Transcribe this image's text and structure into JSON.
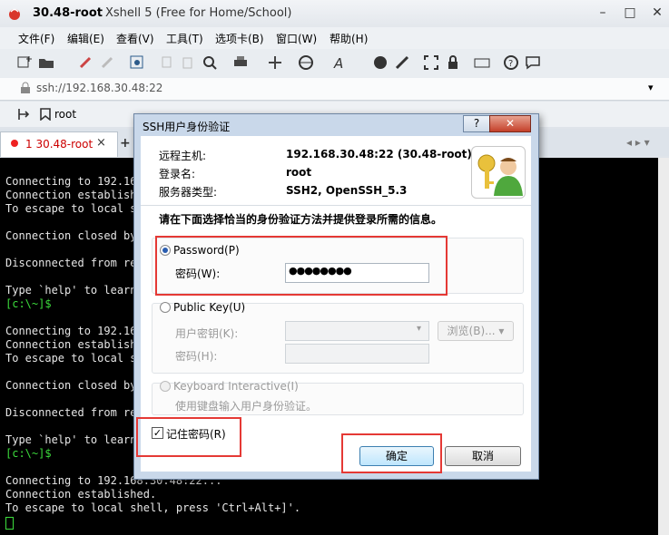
{
  "window": {
    "title_bold": "30.48-root",
    "title_rest": "Xshell 5 (Free for Home/School)",
    "min": "–",
    "max": "□",
    "close": "✕"
  },
  "menu": [
    "文件(F)",
    "编辑(E)",
    "查看(V)",
    "工具(T)",
    "选项卡(B)",
    "窗口(W)",
    "帮助(H)"
  ],
  "address": {
    "url": "ssh://192.168.30.48:22",
    "dropdown": "▾"
  },
  "session_bar": {
    "item": "root"
  },
  "tabs": {
    "active_label": "1 30.48-root",
    "close": "×",
    "add": "+",
    "nav": "◂ ▸ ▾"
  },
  "terminal": {
    "lines": [
      "Connecting to 192.16",
      "Connection establish",
      "To escape to local s",
      "",
      "Connection closed by",
      "",
      "Disconnected from re",
      "",
      "Type `help' to learn",
      "[c:\\~]$",
      "",
      "Connecting to 192.16",
      "Connection establish",
      "To escape to local s",
      "",
      "Connection closed by",
      "",
      "Disconnected from re",
      "",
      "Type `help' to learn",
      "[c:\\~]$",
      "",
      "Connecting to 192.168.30.48:22...",
      "Connection established.",
      "To escape to local shell, press 'Ctrl+Alt+]'."
    ]
  },
  "dialog": {
    "title": "SSH用户身份验证",
    "help": "?",
    "close": "✕",
    "remote_host_label": "远程主机:",
    "remote_host_value": "192.168.30.48:22 (30.48-root)",
    "login_label": "登录名:",
    "login_value": "root",
    "server_type_label": "服务器类型:",
    "server_type_value": "SSH2, OpenSSH_5.3",
    "instruction": "请在下面选择恰当的身份验证方法并提供登录所需的信息。",
    "password": {
      "option": "Password(P)",
      "field_label": "密码(W):",
      "field_value": "●●●●●●●●"
    },
    "public_key": {
      "option": "Public Key(U)",
      "user_key_label": "用户密钥(K):",
      "passphrase_label": "密码(H):",
      "browse": "浏览(B)...",
      "browse_arrow": "▾"
    },
    "keyboard": {
      "option": "Keyboard Interactive(I)",
      "desc": "使用键盘输入用户身份验证。"
    },
    "remember": {
      "label": "记住密码(R)",
      "mark": "✓"
    },
    "ok": "确定",
    "cancel": "取消"
  }
}
